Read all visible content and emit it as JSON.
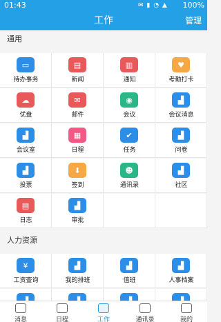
{
  "status": {
    "time": "01:43",
    "battery": "100%"
  },
  "header": {
    "title": "工作",
    "manage": "管理"
  },
  "sections": [
    {
      "title": "通用"
    },
    {
      "title": "人力资源"
    }
  ],
  "colors": {
    "blue": "#2d8ee8",
    "red": "#e8595a",
    "green": "#2bb688",
    "orange": "#f5a843",
    "pink": "#ef5b84",
    "brand": "#24a0e6"
  },
  "general_apps": [
    {
      "label": "待办事务",
      "icon": "inbox-icon",
      "color": "blue"
    },
    {
      "label": "新闻",
      "icon": "news-icon",
      "color": "red"
    },
    {
      "label": "通知",
      "icon": "notice-icon",
      "color": "red"
    },
    {
      "label": "考勤打卡",
      "icon": "location-icon",
      "color": "orange"
    },
    {
      "label": "优盘",
      "icon": "cloud-icon",
      "color": "red"
    },
    {
      "label": "邮件",
      "icon": "mail-icon",
      "color": "red"
    },
    {
      "label": "会议",
      "icon": "meeting-icon",
      "color": "green"
    },
    {
      "label": "会议消息",
      "icon": "chart-icon",
      "color": "blue"
    },
    {
      "label": "会议室",
      "icon": "chart-icon",
      "color": "blue"
    },
    {
      "label": "日程",
      "icon": "calendar-icon",
      "color": "pink"
    },
    {
      "label": "任务",
      "icon": "task-icon",
      "color": "blue"
    },
    {
      "label": "问卷",
      "icon": "chart-icon",
      "color": "blue"
    },
    {
      "label": "投票",
      "icon": "chart-icon",
      "color": "blue"
    },
    {
      "label": "签到",
      "icon": "checkin-icon",
      "color": "orange"
    },
    {
      "label": "通讯录",
      "icon": "contacts-icon",
      "color": "green"
    },
    {
      "label": "社区",
      "icon": "chart-icon",
      "color": "blue"
    },
    {
      "label": "日志",
      "icon": "log-icon",
      "color": "red"
    },
    {
      "label": "审批",
      "icon": "chart-icon",
      "color": "blue"
    }
  ],
  "hr_apps": [
    {
      "label": "工资查询",
      "icon": "salary-icon",
      "color": "blue"
    },
    {
      "label": "我的排班",
      "icon": "chart-icon",
      "color": "blue"
    },
    {
      "label": "值班",
      "icon": "chart-icon",
      "color": "blue"
    },
    {
      "label": "人事档案",
      "icon": "chart-icon",
      "color": "blue"
    },
    {
      "label": "",
      "icon": "chart-icon",
      "color": "blue"
    },
    {
      "label": "",
      "icon": "chart-icon",
      "color": "blue"
    },
    {
      "label": "",
      "icon": "chart-icon",
      "color": "blue"
    },
    {
      "label": "",
      "icon": "chart-icon",
      "color": "blue"
    }
  ],
  "tabs": [
    {
      "label": "消息",
      "active": false
    },
    {
      "label": "日程",
      "active": false
    },
    {
      "label": "工作",
      "active": true
    },
    {
      "label": "通讯录",
      "active": false
    },
    {
      "label": "我的",
      "active": false
    }
  ]
}
